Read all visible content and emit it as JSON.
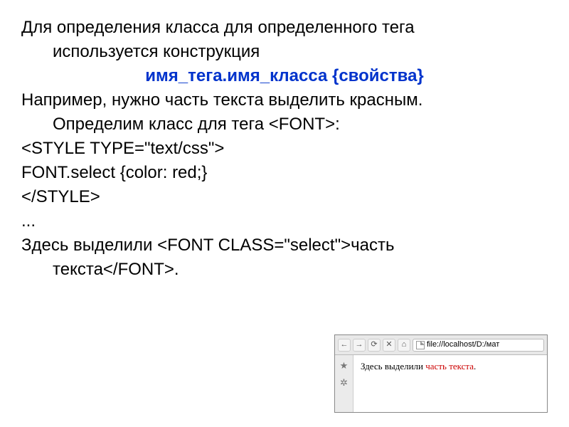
{
  "para1_a": "Для определения класса для определенного тега",
  "para1_b": "используется конструкция",
  "syntax": "имя_тега.имя_класса {свойства}",
  "para2_a": "Например, нужно часть текста выделить красным.",
  "para2_b": "Определим класс для тега <FONT>:",
  "code1": "<STYLE TYPE=\"text/css\">",
  "code2": "FONT.select {color: red;}",
  "code3": "</STYLE>",
  "ellipsis": "...",
  "para3_a": "Здесь выделили <FONT CLASS=\"select\">часть",
  "para3_b": "текста</FONT>.",
  "browser": {
    "address": "file://localhost/D:/мат",
    "content_black": "Здесь выделили ",
    "content_red": "часть текста",
    "content_period": ".",
    "icons": {
      "back": "←",
      "forward": "→",
      "reload": "⟳",
      "stop": "✕",
      "home": "⌂",
      "star": "★",
      "gear": "✲"
    }
  }
}
